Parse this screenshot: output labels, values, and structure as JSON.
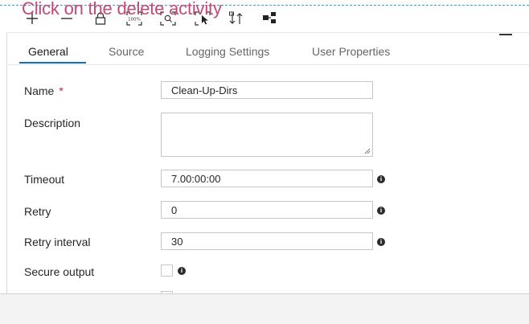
{
  "overlay": {
    "caption": "Click on the delete activity"
  },
  "toolbar": {
    "icons": [
      "plus-icon",
      "minus-icon",
      "lock-icon",
      "zoom-100-icon",
      "zoom-fit-icon",
      "select-cursor-icon",
      "sort-arrange-icon",
      "layout-icon"
    ],
    "zoom_100_label": "100%"
  },
  "tabs": [
    {
      "label": "General",
      "active": true
    },
    {
      "label": "Source",
      "active": false
    },
    {
      "label": "Logging Settings",
      "active": false
    },
    {
      "label": "User Properties",
      "active": false
    }
  ],
  "form": {
    "name": {
      "label": "Name",
      "required_marker": "*",
      "value": "Clean-Up-Dirs"
    },
    "description": {
      "label": "Description",
      "value": ""
    },
    "timeout": {
      "label": "Timeout",
      "value": "7.00:00:00"
    },
    "retry": {
      "label": "Retry",
      "value": "0"
    },
    "retry_interval": {
      "label": "Retry interval",
      "value": "30"
    },
    "secure_output": {
      "label": "Secure output",
      "checked": false
    }
  },
  "colors": {
    "accent": "#1070c4",
    "caption": "#c2497a",
    "required": "#c4262e",
    "dash": "#35a3d8"
  }
}
